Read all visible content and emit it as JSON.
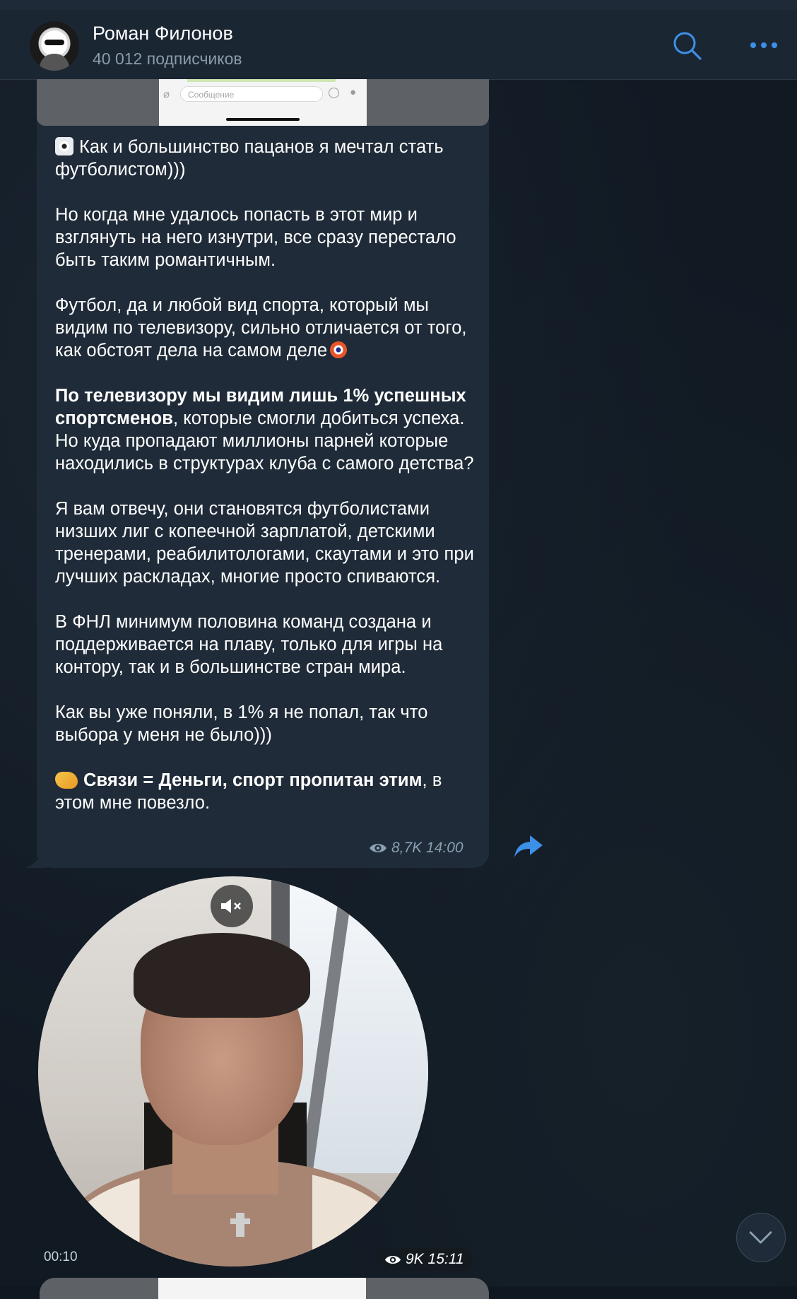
{
  "header": {
    "title": "Роман Филонов",
    "subtitle": "40 012 подписчиков",
    "search_icon": "search-icon",
    "more_icon": "more-icon"
  },
  "message": {
    "screenshot_input_placeholder": "Сообщение",
    "p1": "Как и большинство пацанов я мечтал стать футболистом)))",
    "p2": "Но когда мне удалось попасть в этот мир и взглянуть на него изнутри, все сразу перестало быть таким романтичным.",
    "p3": "Футбол, да и любой вид спорта, который мы видим по телевизору, сильно отличается от того, как обстоят дела на самом деле",
    "p4_bold": "По телевизору мы видим лишь 1% успешных спортсменов",
    "p4_rest": ", которые смогли добиться успеха. Но куда пропадают миллионы парней которые находились в структурах клуба с самого детства?",
    "p5": "Я вам отвечу, они становятся футболистами низших лиг с копеечной зарплатой, детскими тренерами, реабилитологами, скаутами и это при лучших раскладах, многие просто спиваются.",
    "p6": "В ФНЛ минимум половина команд создана и поддерживается на плаву, только для игры на контору, так и в большинстве стран мира.",
    "p7": "Как вы уже поняли, в 1% я не попал, так что выбора у меня не было)))",
    "p8_bold": "Связи = Деньги, спорт пропитан этим",
    "p8_rest": ", в этом мне повезло.",
    "views": "8,7K",
    "time": "14:00"
  },
  "video": {
    "duration": "00:10",
    "views": "9K",
    "time": "15:11"
  },
  "colors": {
    "accent": "#3d8fe8",
    "bubble": "#1f2b38",
    "header": "#1b2633"
  }
}
